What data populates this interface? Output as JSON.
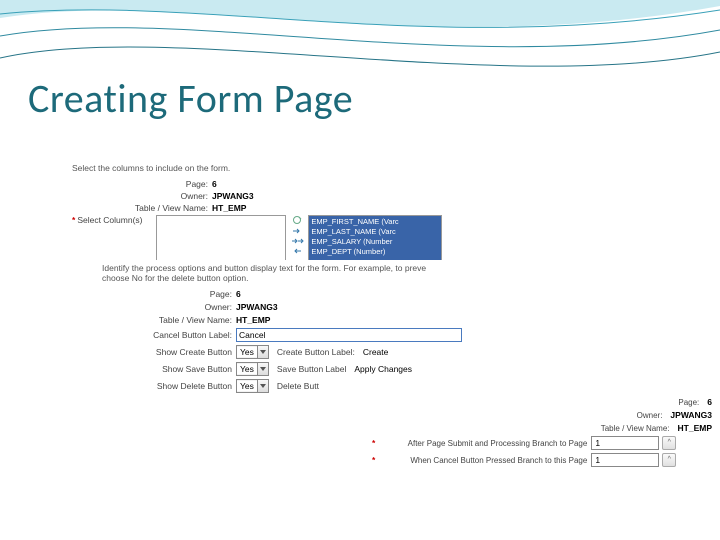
{
  "title": "Creating Form Page",
  "panel1": {
    "instruction": "Select the columns to include on the form.",
    "page_lbl": "Page:",
    "page_val": "6",
    "owner_lbl": "Owner:",
    "owner_val": "JPWANG3",
    "table_lbl": "Table / View Name:",
    "table_val": "HT_EMP",
    "select_cols_lbl": "Select Column(s)",
    "selected_cols": [
      "EMP_FIRST_NAME (Varc",
      "EMP_LAST_NAME (Varc",
      "EMP_SALARY (Number",
      "EMP_DEPT (Number)"
    ]
  },
  "panel2": {
    "instruction1": "Identify the process options and button display text for the form. For example, to preve",
    "instruction2": "choose No for the delete button option.",
    "page_lbl": "Page:",
    "page_val": "6",
    "owner_lbl": "Owner:",
    "owner_val": "JPWANG3",
    "table_lbl": "Table / View Name:",
    "table_val": "HT_EMP",
    "cancel_lbl": "Cancel Button Label:",
    "cancel_val": "Cancel",
    "show_create_lbl": "Show Create Button",
    "yes": "Yes",
    "create_label_lbl": "Create Button Label:",
    "create_label_val": "Create",
    "show_save_lbl": "Show Save Button",
    "save_label_lbl": "Save Button Label",
    "save_label_val": "Apply Changes",
    "show_delete_lbl": "Show Delete Button",
    "delete_label_lbl": "Delete Butt"
  },
  "panel3": {
    "page_lbl": "Page:",
    "page_val": "6",
    "owner_lbl": "Owner:",
    "owner_val": "JPWANG3",
    "table_lbl": "Table / View Name:",
    "table_val": "HT_EMP",
    "after_lbl": "After Page Submit and Processing Branch to Page",
    "after_val": "1",
    "cancel_lbl": "When Cancel Button Pressed Branch to this Page",
    "cancel_val": "1"
  }
}
